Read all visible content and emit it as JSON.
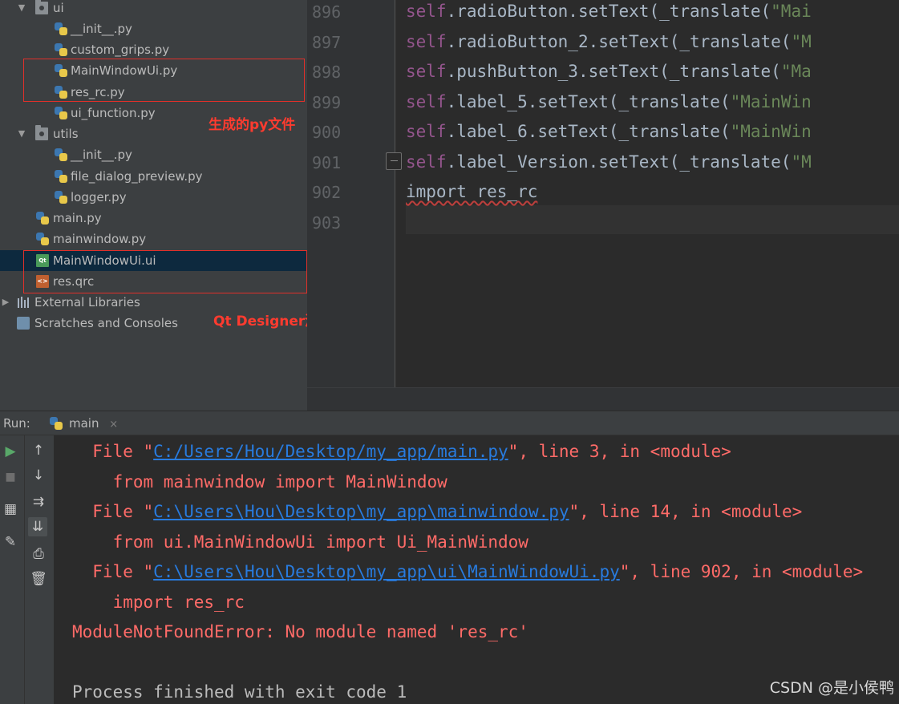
{
  "project_tree": {
    "items": [
      {
        "label": "ui",
        "icon": "folder-icon",
        "expanded": true
      },
      {
        "label": "__init__.py",
        "icon": "python-file-icon"
      },
      {
        "label": "custom_grips.py",
        "icon": "python-file-icon"
      },
      {
        "label": "MainWindowUi.py",
        "icon": "python-file-icon"
      },
      {
        "label": "res_rc.py",
        "icon": "python-file-icon"
      },
      {
        "label": "ui_function.py",
        "icon": "python-file-icon"
      },
      {
        "label": "utils",
        "icon": "folder-icon",
        "expanded": true
      },
      {
        "label": "__init__.py",
        "icon": "python-file-icon"
      },
      {
        "label": "file_dialog_preview.py",
        "icon": "python-file-icon"
      },
      {
        "label": "logger.py",
        "icon": "python-file-icon"
      },
      {
        "label": "main.py",
        "icon": "python-file-icon"
      },
      {
        "label": "mainwindow.py",
        "icon": "python-file-icon"
      },
      {
        "label": "MainWindowUi.ui",
        "icon": "qt-ui-file-icon",
        "selected": true
      },
      {
        "label": "res.qrc",
        "icon": "qrc-file-icon"
      },
      {
        "label": "External Libraries",
        "icon": "library-icon"
      },
      {
        "label": "Scratches and Consoles",
        "icon": "scratches-icon"
      }
    ],
    "annotations": {
      "generated_py": "生成的py文件",
      "designer_source": "Qt Designer源文件"
    }
  },
  "editor": {
    "lines": [
      {
        "num": "896",
        "self": "self",
        "method": ".radioButton.setText(_translate(",
        "str": "\"Mai"
      },
      {
        "num": "897",
        "self": "self",
        "method": ".radioButton_2.setText(_translate(",
        "str": "\"M"
      },
      {
        "num": "898",
        "self": "self",
        "method": ".pushButton_3.setText(_translate(",
        "str": "\"Ma"
      },
      {
        "num": "899",
        "self": "self",
        "method": ".label_5.setText(_translate(",
        "str": "\"MainWin"
      },
      {
        "num": "900",
        "self": "self",
        "method": ".label_6.setText(_translate(",
        "str": "\"MainWin"
      },
      {
        "num": "901",
        "self": "self",
        "method": ".label_Version.setText(_translate(",
        "str": "\"M"
      },
      {
        "num": "902",
        "code": "import res_rc"
      },
      {
        "num": "903",
        "code": ""
      }
    ]
  },
  "run": {
    "label": "Run:",
    "tab": "main",
    "tab_close": "×",
    "console": [
      {
        "type": "trace",
        "pre": "  File \"",
        "link": "C:/Users/Hou/Desktop/my_app/main.py",
        "post": "\", line 3, in <module>"
      },
      {
        "type": "code",
        "text": "    from mainwindow import MainWindow"
      },
      {
        "type": "trace",
        "pre": "  File \"",
        "link": "C:\\Users\\Hou\\Desktop\\my_app\\mainwindow.py",
        "post": "\", line 14, in <module>"
      },
      {
        "type": "code",
        "text": "    from ui.MainWindowUi import Ui_MainWindow"
      },
      {
        "type": "trace",
        "pre": "  File \"",
        "link": "C:\\Users\\Hou\\Desktop\\my_app\\ui\\MainWindowUi.py",
        "post": "\", line 902, in <module>"
      },
      {
        "type": "code",
        "text": "    import res_rc"
      },
      {
        "type": "error",
        "text": "ModuleNotFoundError: No module named 'res_rc'"
      },
      {
        "type": "blank",
        "text": ""
      },
      {
        "type": "normal",
        "text": "Process finished with exit code 1"
      }
    ]
  },
  "watermark": "CSDN @是小侯鸭"
}
